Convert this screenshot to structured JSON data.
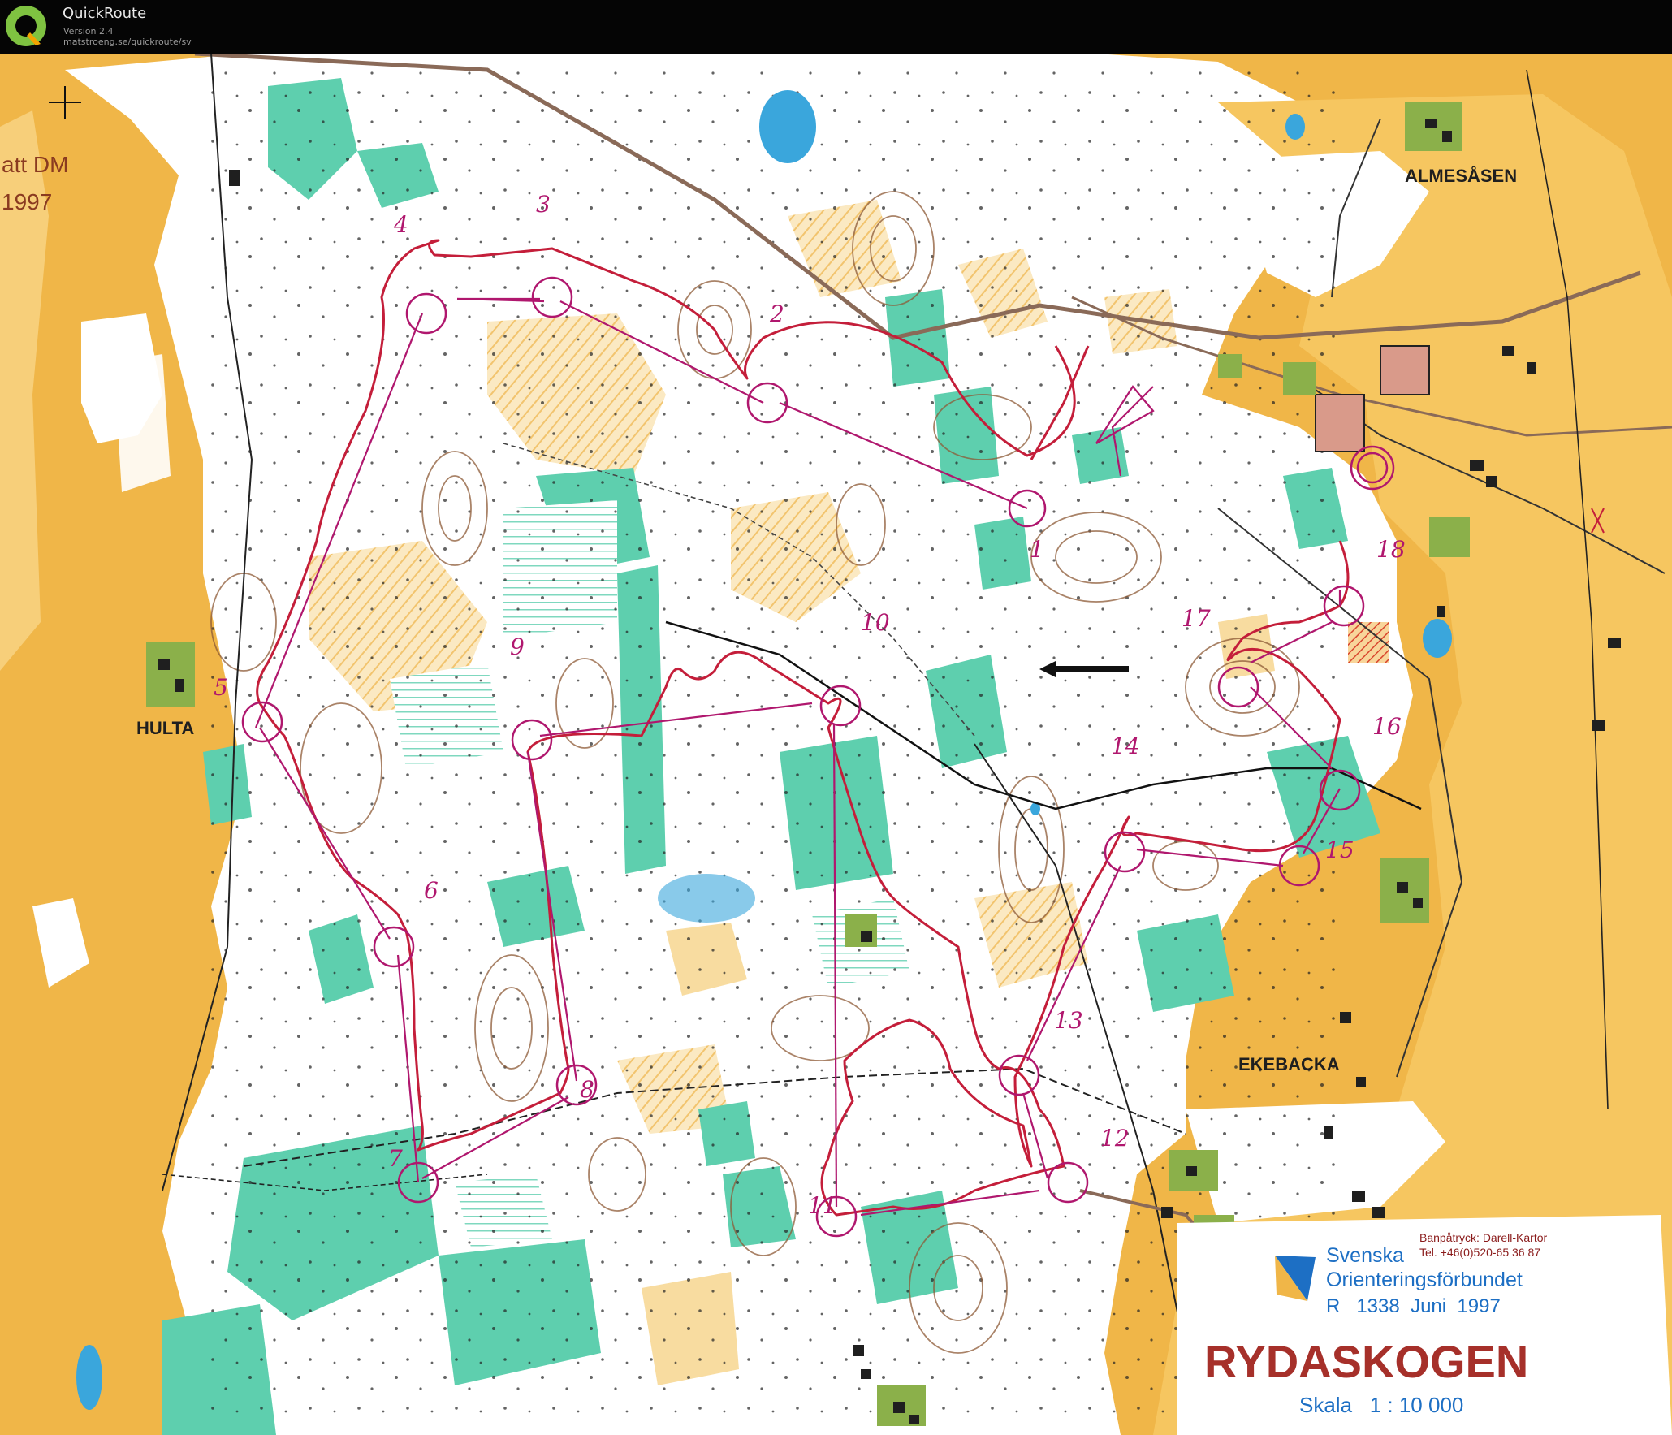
{
  "app": {
    "title": "QuickRoute",
    "version": "Version 2.4",
    "url": "matstroeng.se/quickroute/sv"
  },
  "map": {
    "edge_fragment_1": "att DM",
    "edge_fragment_2": "1997",
    "place_names": {
      "almesasen": "ALMESÅSEN",
      "hulta": "HULTA",
      "ekebacka": "EKEBACKA"
    },
    "controls": [
      "1",
      "2",
      "3",
      "4",
      "5",
      "6",
      "7",
      "8",
      "9",
      "10",
      "11",
      "12",
      "13",
      "14",
      "15",
      "16",
      "17",
      "18"
    ],
    "legend": {
      "org_line1": "Svenska",
      "org_line2": "Orienteringsförbundet",
      "print_line1": "Banpåtryck: Darell-Kartor",
      "print_line2": "Tel. +46(0)520-65 36 87",
      "registration": "R   1338  Juni  1997",
      "map_name": "RYDASKOGEN",
      "scale": "Skala   1 : 10 000"
    },
    "colors": {
      "open_land": "#f0b648",
      "forest": "#ffffff",
      "green": "#5ecfae",
      "course": "#b0176e",
      "route": "#c41e3a",
      "contour": "#8d5a36",
      "water": "#3aa6dc",
      "road": "#8a6a58",
      "building": "#1f1f1f",
      "legend_blue": "#1d6fc4",
      "legend_red": "#a6302a"
    }
  }
}
